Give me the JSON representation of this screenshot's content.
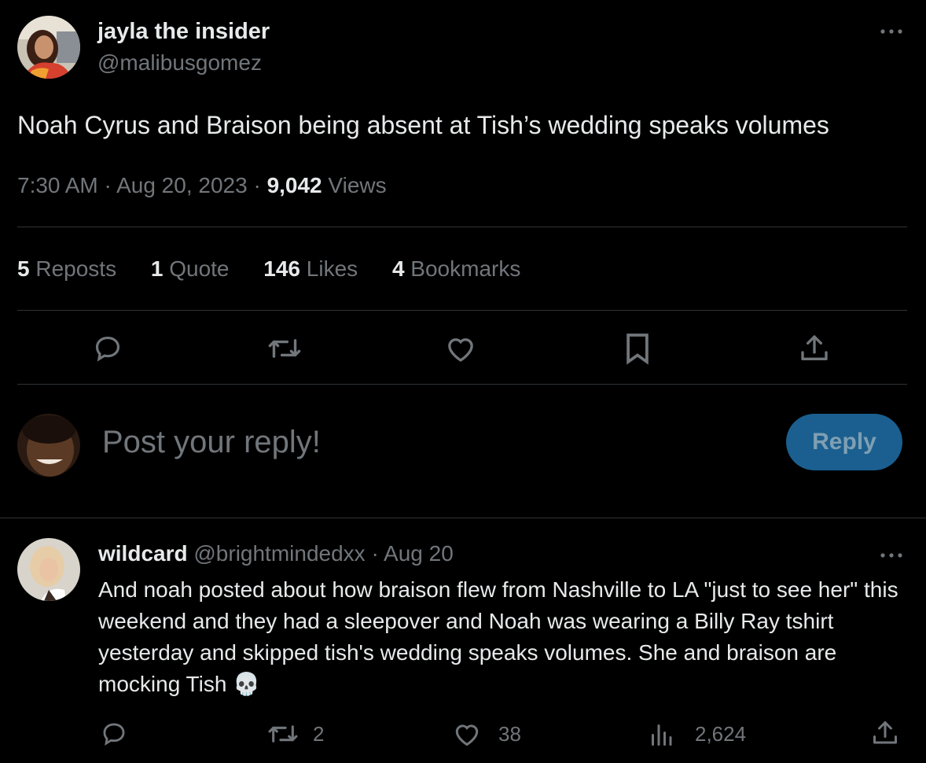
{
  "tweet": {
    "display_name": "jayla the insider",
    "handle": "@malibusgomez",
    "text": "Noah Cyrus and Braison being absent at Tish’s wedding speaks volumes",
    "time": "7:30 AM",
    "sep1": "·",
    "date": "Aug 20, 2023",
    "sep2": "·",
    "views_count": "9,042",
    "views_label": "Views"
  },
  "stats": {
    "reposts_count": "5",
    "reposts_label": "Reposts",
    "quote_count": "1",
    "quote_label": "Quote",
    "likes_count": "146",
    "likes_label": "Likes",
    "bookmarks_count": "4",
    "bookmarks_label": "Bookmarks"
  },
  "composer": {
    "placeholder": "Post your reply!",
    "reply_label": "Reply"
  },
  "reply": {
    "display_name": "wildcard",
    "handle": "@brightmindedxx",
    "sep": "·",
    "date": "Aug 20",
    "text": "And noah posted about how braison flew from Nashville to LA \"just to see her\" this weekend and they had a sleepover and Noah was wearing a Billy Ray tshirt yesterday and skipped tish's wedding speaks volumes. She and braison are mocking Tish 💀",
    "retweets": "2",
    "likes": "38",
    "views": "2,624"
  },
  "icons": {
    "more": "more-dots-icon",
    "reply": "reply-bubble-icon",
    "retweet": "retweet-icon",
    "like": "heart-icon",
    "bookmark": "bookmark-icon",
    "share": "share-icon",
    "views": "analytics-icon"
  },
  "colors": {
    "background": "#000000",
    "text": "#e7e9ea",
    "muted": "#71767b",
    "divider": "#2f3336",
    "reply_button": "#1a5f8f"
  }
}
